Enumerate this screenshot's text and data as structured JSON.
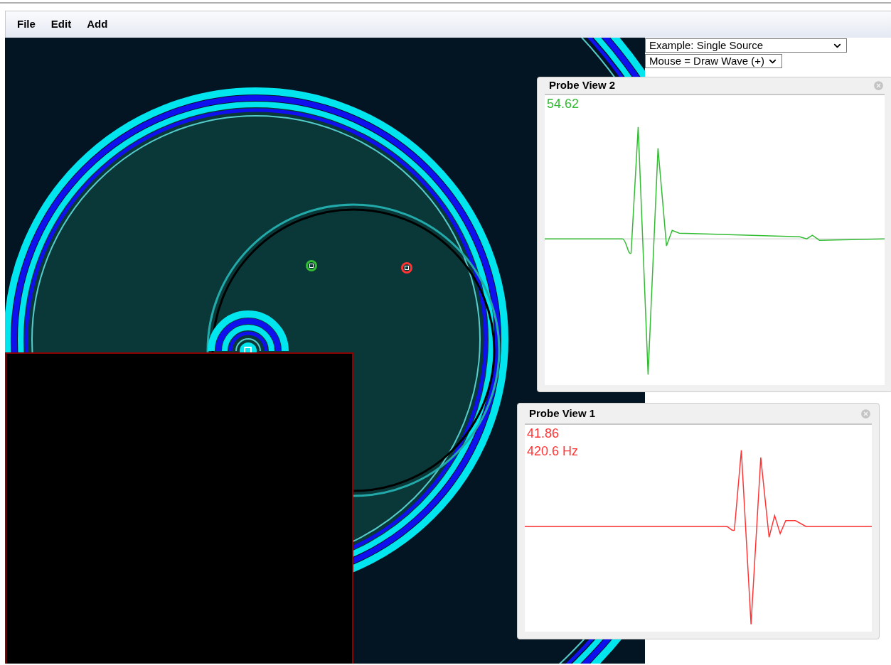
{
  "menu": [
    {
      "label": "File"
    },
    {
      "label": "Edit"
    },
    {
      "label": "Add"
    }
  ],
  "dropdowns": [
    {
      "value": "Example: Single Source"
    },
    {
      "value": "Mouse = Draw Wave (+)"
    }
  ],
  "probes": [
    {
      "title": "Probe View 2",
      "color": "#33bb33",
      "readings": [
        "54.62"
      ]
    },
    {
      "title": "Probe View 1",
      "color": "#ff3333",
      "readings": [
        "41.86",
        "420.6 Hz"
      ]
    }
  ]
}
